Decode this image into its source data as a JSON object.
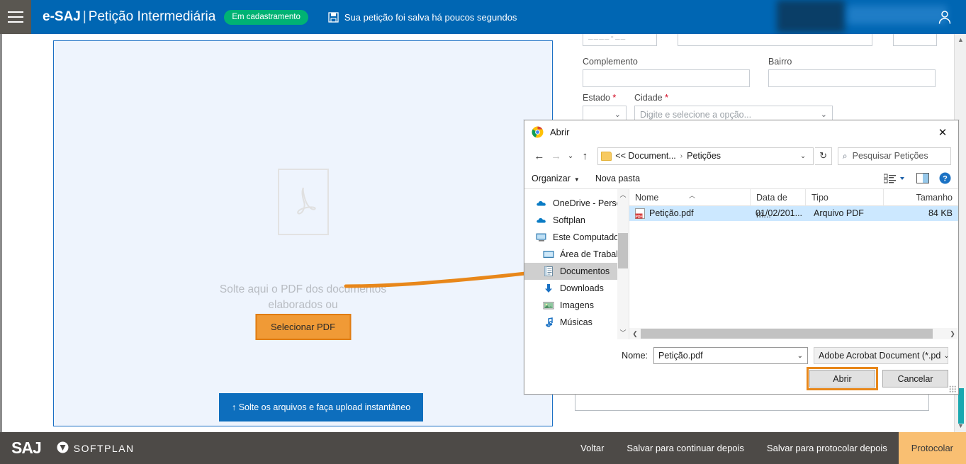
{
  "header": {
    "menu_icon": "hamburger-icon",
    "brand": "e-SAJ",
    "separator": "|",
    "page_name": "Petição Intermediária",
    "status_badge": "Em cadastramento",
    "save_icon": "floppy-save-icon",
    "save_message": "Sua petição foi salva há poucos segundos",
    "user_icon": "user-avatar-icon",
    "bg_color": "#0066b3",
    "badge_color": "#00b274"
  },
  "dropzone": {
    "placeholder_icon": "pdf-document-icon",
    "instruction_line1": "Solte aqui o PDF dos documentos",
    "instruction_line2": "elaborados ou",
    "select_button": "Selecionar PDF",
    "instant_upload_button": "↑ Solte os arquivos e faça upload instantâneo",
    "border_color": "#1a6fc4",
    "fill_color": "#eef4fd",
    "select_button_color": "#f09a36",
    "upload_button_color": "#0d6ebd"
  },
  "form": {
    "cep_mask": "____-__",
    "fields": [
      {
        "label": "Complemento",
        "required": false,
        "value": "",
        "placeholder": ""
      },
      {
        "label": "Bairro",
        "required": false,
        "value": "",
        "placeholder": ""
      }
    ],
    "estado_label": "Estado",
    "estado_required": "*",
    "cidade_label": "Cidade",
    "cidade_required": "*",
    "cidade_placeholder": "Digite e selecione a opção...",
    "chevron_icon": "chevron-down-icon"
  },
  "footer": {
    "brand_saj": "SAJ",
    "brand_softplan": "SOFTPLAN",
    "softplan_icon": "softplan-shield-icon",
    "links": [
      "Voltar",
      "Salvar para continuar depois",
      "Salvar para protocolar depois"
    ],
    "primary_button": "Protocolar",
    "bg_color": "#4d4a47",
    "primary_color": "#f9bf72"
  },
  "file_dialog": {
    "app_icon": "chrome-icon",
    "title": "Abrir",
    "close_icon": "close-icon",
    "nav": {
      "back_icon": "arrow-left-icon",
      "forward_icon": "arrow-right-icon",
      "recent_icon": "chevron-down-icon",
      "up_icon": "arrow-up-icon",
      "refresh_icon": "refresh-icon",
      "folder_icon": "folder-icon",
      "breadcrumb": [
        "<< Document...",
        "Petições"
      ],
      "breadcrumb_sep": "›",
      "breadcrumb_chevron": "chevron-down-icon"
    },
    "search": {
      "icon": "search-icon",
      "placeholder": "Pesquisar Petições",
      "value": ""
    },
    "toolbar": {
      "organize": "Organizar",
      "new_folder": "Nova pasta",
      "view_icon": "view-list-icon",
      "view_caret": "chevron-down-icon",
      "preview_pane_icon": "preview-pane-icon",
      "help_icon": "help-icon"
    },
    "sidebar": {
      "items": [
        {
          "label": "OneDrive - Person",
          "icon": "onedrive-cloud-icon",
          "indent": false,
          "selected": false
        },
        {
          "label": "Softplan",
          "icon": "onedrive-cloud-icon",
          "indent": false,
          "selected": false
        },
        {
          "label": "Este Computador",
          "icon": "computer-icon",
          "indent": false,
          "selected": false
        },
        {
          "label": "Área de Trabalho",
          "icon": "desktop-icon",
          "indent": true,
          "selected": false
        },
        {
          "label": "Documentos",
          "icon": "documents-icon",
          "indent": true,
          "selected": true
        },
        {
          "label": "Downloads",
          "icon": "downloads-arrow-icon",
          "indent": true,
          "selected": false
        },
        {
          "label": "Imagens",
          "icon": "pictures-icon",
          "indent": true,
          "selected": false
        },
        {
          "label": "Músicas",
          "icon": "music-note-icon",
          "indent": true,
          "selected": false
        }
      ],
      "scroll_up_icon": "chevron-up-icon",
      "scroll_down_icon": "chevron-down-icon"
    },
    "file_list": {
      "columns": [
        "Nome",
        "Data de m...",
        "Tipo",
        "Tamanho"
      ],
      "sort_indicator": "caret-up-icon",
      "rows": [
        {
          "icon": "pdf-file-icon",
          "name": "Petição.pdf",
          "modified": "01/02/201...",
          "type": "Arquivo PDF",
          "size": "84 KB",
          "selected": true
        }
      ],
      "hscroll_left_icon": "chevron-left-icon",
      "hscroll_right_icon": "chevron-right-icon"
    },
    "filename": {
      "label": "Nome:",
      "value": "Petição.pdf",
      "chevron_icon": "chevron-down-icon"
    },
    "filetype": {
      "value": "Adobe Acrobat Document (*.pd",
      "chevron_icon": "chevron-down-icon"
    },
    "buttons": {
      "open": "Abrir",
      "cancel": "Cancelar",
      "highlight_color": "#e8871a"
    }
  },
  "annotation": {
    "arrow_color": "#e8871a",
    "arrow_from": "Selecionar PDF",
    "arrow_to": "Petição.pdf"
  }
}
